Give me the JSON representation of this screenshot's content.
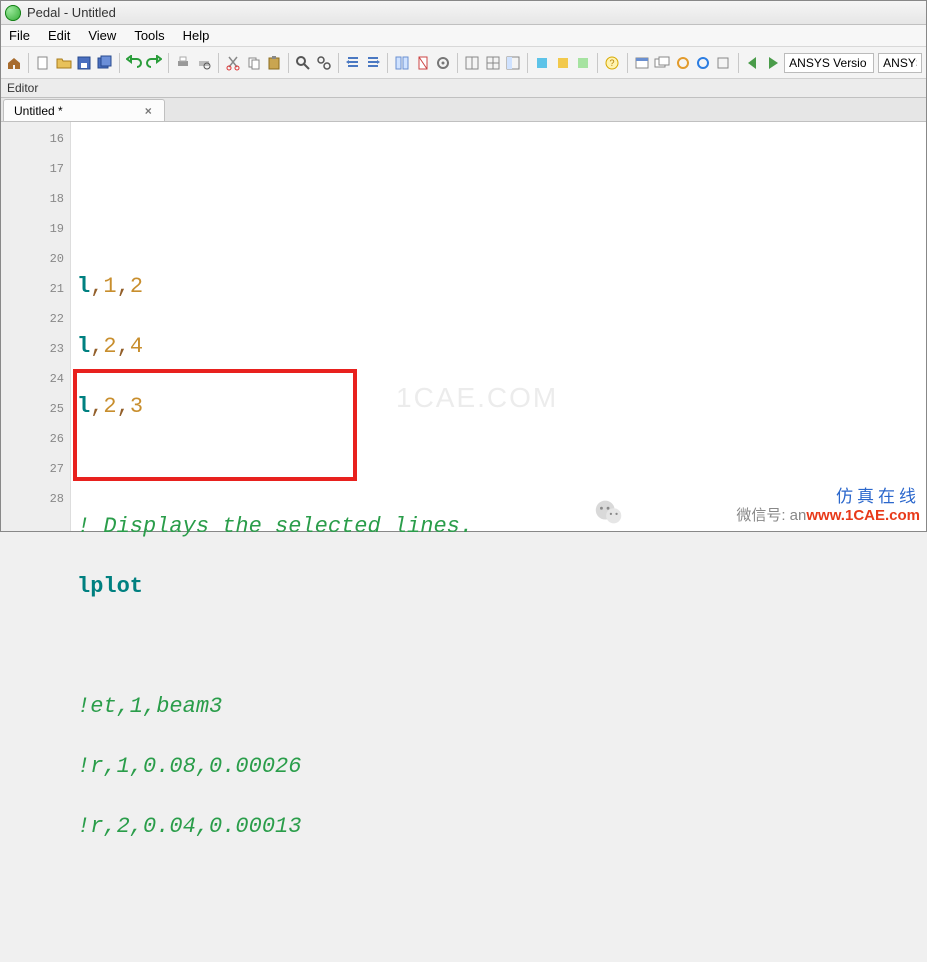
{
  "window": {
    "title": "Pedal - Untitled"
  },
  "menu": {
    "file": "File",
    "edit": "Edit",
    "view": "View",
    "tools": "Tools",
    "help": "Help"
  },
  "toolbar": {
    "version_label": "ANSYS Versio",
    "version_short": "ANSYS"
  },
  "panel": {
    "editor_label": "Editor"
  },
  "tab": {
    "label": "Untitled *",
    "close": "×"
  },
  "gutter": [
    "16",
    "17",
    "18",
    "19",
    "20",
    "21",
    "22",
    "23",
    "24",
    "25",
    "26",
    "27",
    "28"
  ],
  "code": {
    "r0": "",
    "r1": "",
    "r2a": "l",
    "r2b": ",",
    "r2c": "1",
    "r2d": ",",
    "r2e": "2",
    "r3a": "l",
    "r3b": ",",
    "r3c": "2",
    "r3d": ",",
    "r3e": "4",
    "r4a": "l",
    "r4b": ",",
    "r4c": "2",
    "r4d": ",",
    "r4e": "3",
    "r5": "",
    "r6": "! Displays the selected lines.",
    "r7": "lplot",
    "r8": "",
    "r9": "!et,1,beam3",
    "r10": "!r,1,0.08,0.00026",
    "r11": "!r,2,0.04,0.00013",
    "r12": ""
  },
  "watermark": {
    "center": "1CAE.COM",
    "line1": "仿真在线",
    "line2": "微信号: an",
    "line3": "www.1CAE.com"
  }
}
